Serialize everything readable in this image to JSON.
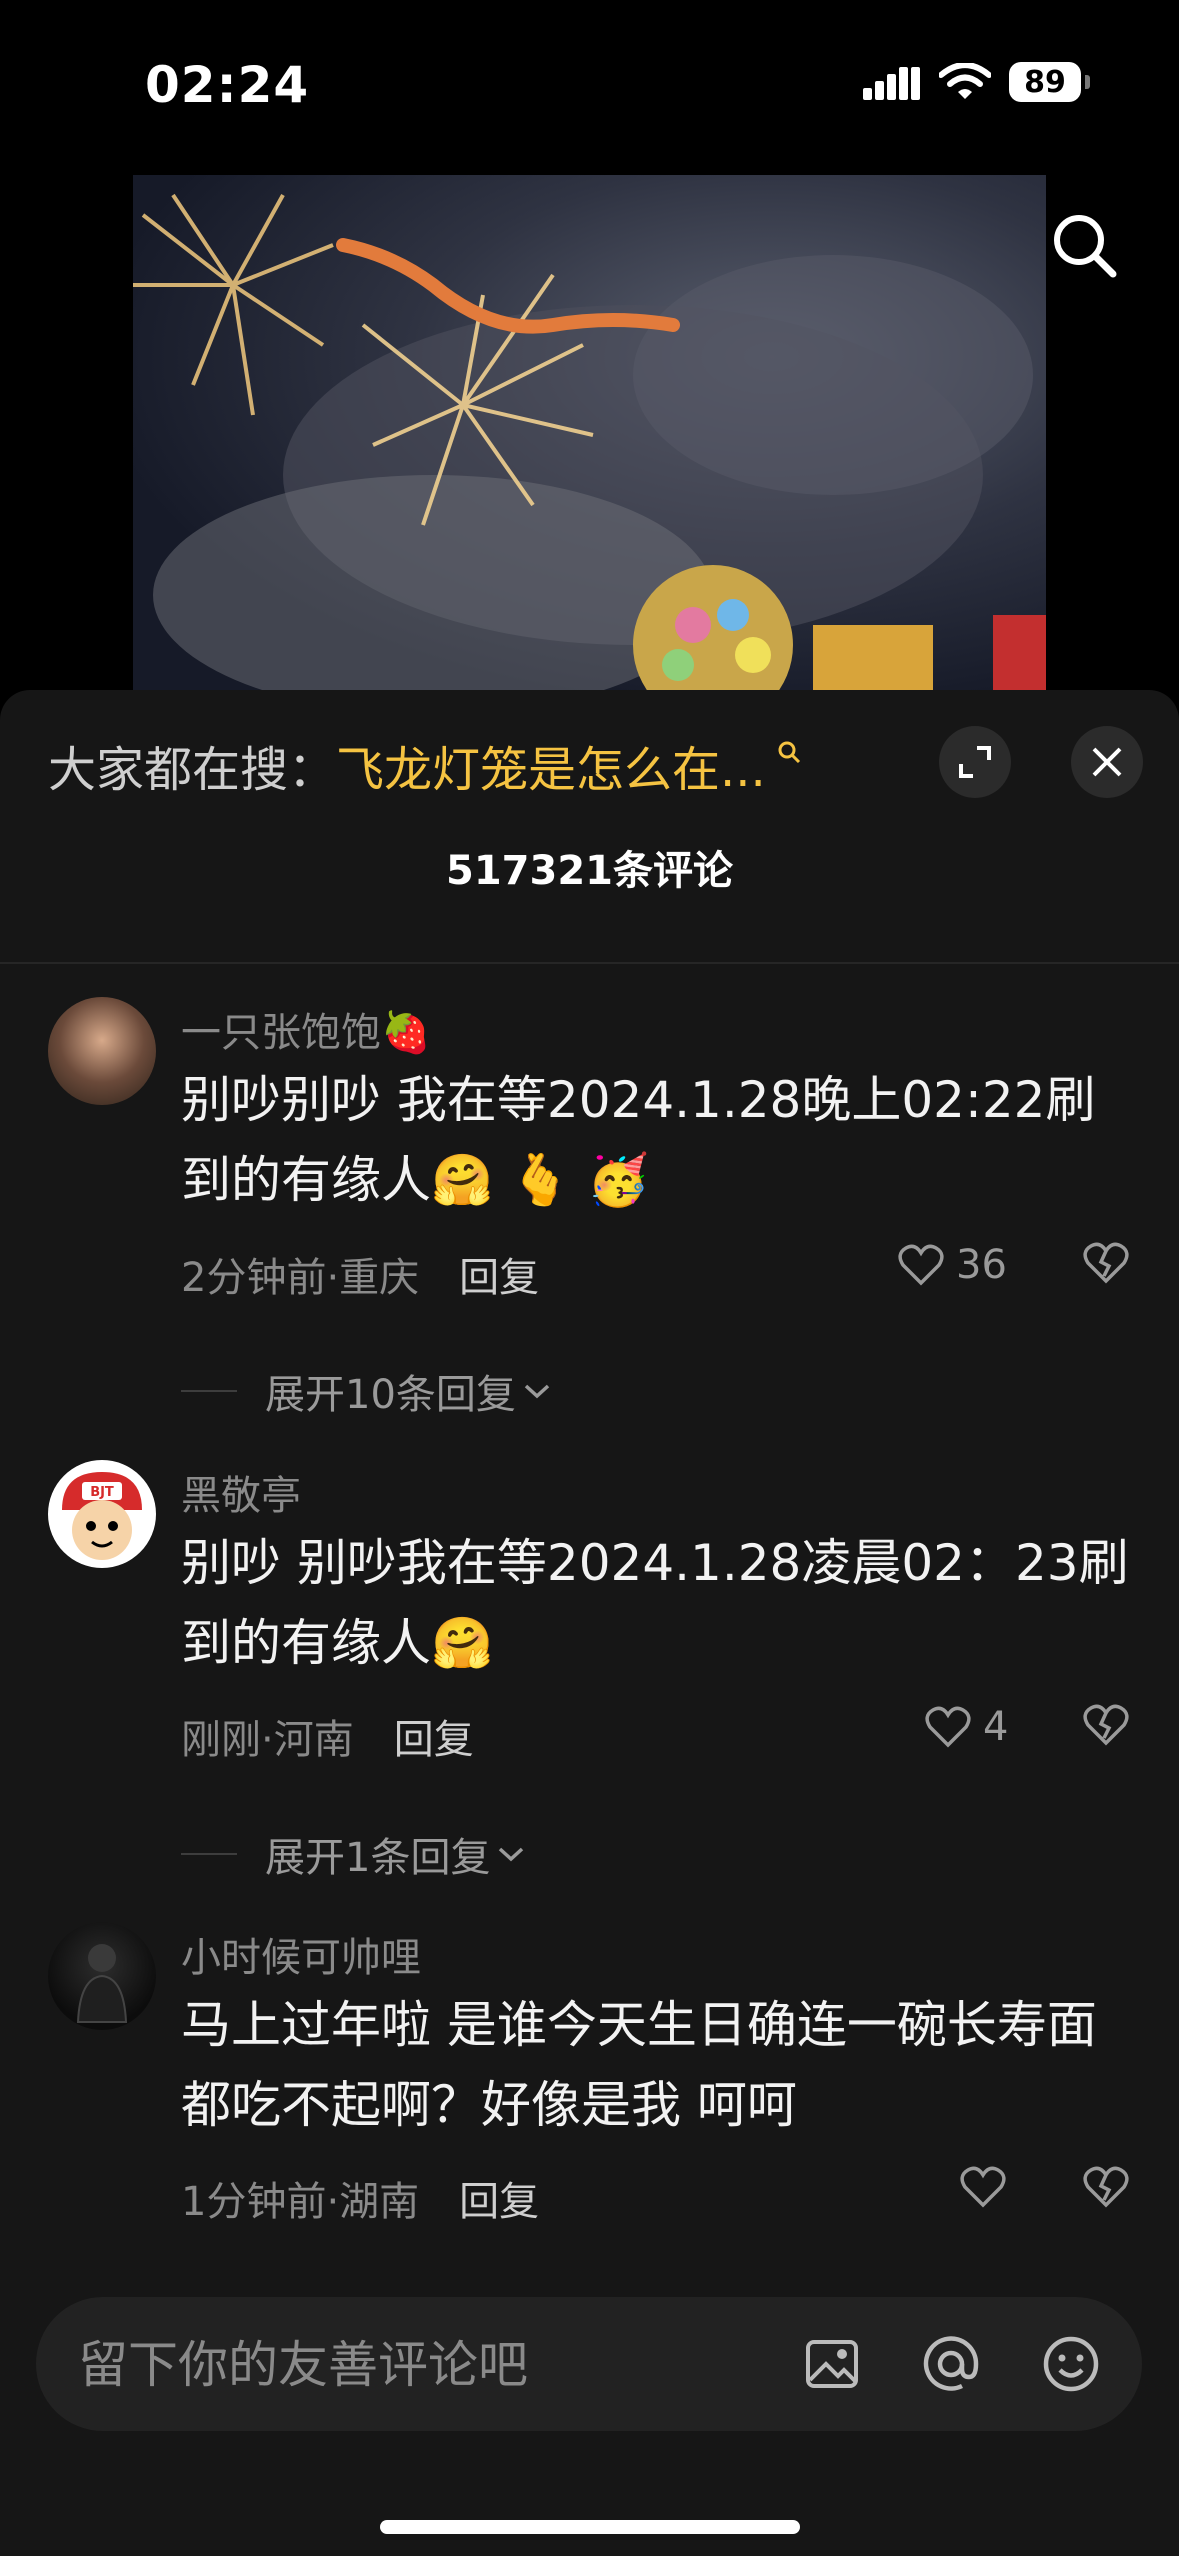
{
  "status_bar": {
    "time": "02:24",
    "battery": "89"
  },
  "video": {
    "search_icon": "search-icon"
  },
  "panel": {
    "search_prefix": "大家都在搜：",
    "search_hot_text": "飞龙灯笼是怎么在...",
    "comment_count": "517321条评论"
  },
  "comments": [
    {
      "username": "一只张饱饱🍓",
      "text": "别吵别吵 我在等2024.1.28晚上02:22刷到的有缘人🤗 🫰 🥳",
      "time_location": "2分钟前·重庆",
      "reply_label": "回复",
      "likes": "36",
      "expand_label": "展开10条回复"
    },
    {
      "username": "黑敬亭",
      "text": "别吵 别吵我在等2024.1.28凌晨02：23刷到的有缘人🤗",
      "time_location": "刚刚·河南",
      "reply_label": "回复",
      "likes": "4",
      "expand_label": "展开1条回复"
    },
    {
      "username": "小时候可帅哩",
      "text": "马上过年啦 是谁今天生日确连一碗长寿面都吃不起啊？好像是我 呵呵",
      "time_location": "1分钟前·湖南",
      "reply_label": "回复",
      "likes": ""
    }
  ],
  "avatar_badge": "BJT",
  "input": {
    "placeholder": "留下你的友善评论吧"
  },
  "colors": {
    "sheet_bg": "#161616",
    "accent_hot": "#f5c342",
    "muted_text": "#8a8a8a"
  }
}
